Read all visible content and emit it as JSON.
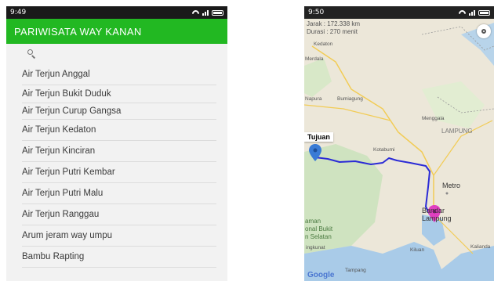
{
  "left_phone": {
    "status_time": "9:49",
    "app_title": "PARIWISATA WAY KANAN",
    "items": [
      "Air Terjun Anggal",
      "Air Terjun Bukit Duduk",
      "Air Terjun Curup Gangsa",
      "Air Terjun Kedaton",
      "Air Terjun Kinciran",
      "Air Terjun Putri Kembar",
      "Air Terjun Putri Malu",
      "Air Terjun Ranggau",
      "Arum jeram way umpu",
      "Bambu Rapting"
    ]
  },
  "right_phone": {
    "status_time": "9:50",
    "distance": "Jarak : 172.338 km",
    "duration": "Durasi : 270 menit",
    "destination_label": "Tujuan",
    "places": {
      "kedaton": "Kedaton",
      "merdala": "Merdala",
      "napura": "Napura",
      "bumiagung": "Bumiagung",
      "menggala": "Menggala",
      "lampung": "LAMPUNG",
      "kotabumi": "Kotabumi",
      "metro": "Metro",
      "bandar_lampung": "Bandar Lampung",
      "taman": "aman",
      "nal_bukit": "onal Bukit",
      "n_selatan": "n Selatan",
      "tanggamus": "ingkunat",
      "kiluan": "Kiluan",
      "kalianda": "Kalianda",
      "tampang": "Tampang"
    },
    "attribution": "Google"
  },
  "colors": {
    "app_bar": "#22b822",
    "route": "#2b2bd6",
    "start_marker": "#3a7bd5",
    "end_marker": "#e040c0"
  }
}
